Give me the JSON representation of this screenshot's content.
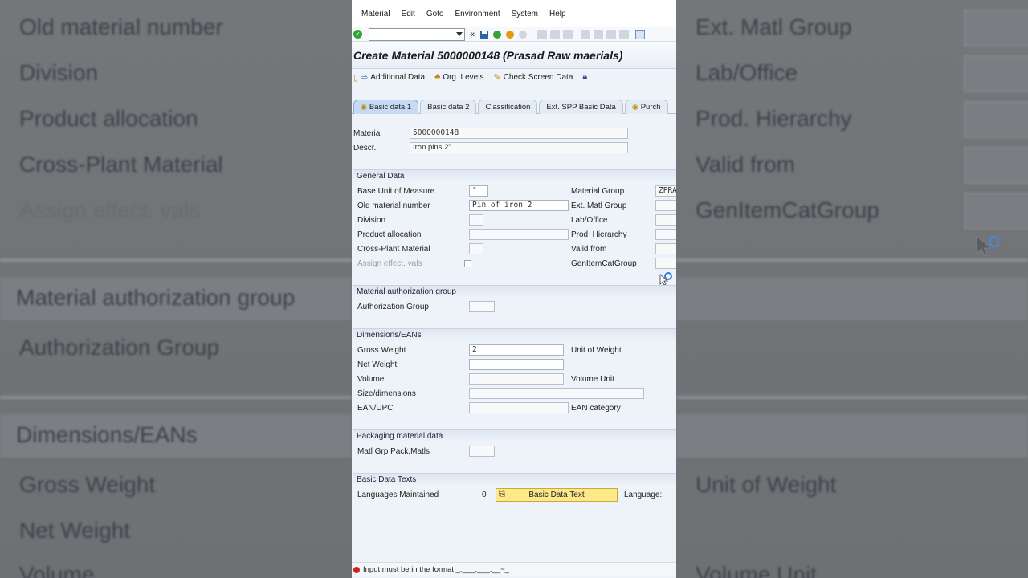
{
  "menu": [
    {
      "label": "Material"
    },
    {
      "label": "Edit"
    },
    {
      "label": "Goto"
    },
    {
      "label": "Environment"
    },
    {
      "label": "System"
    },
    {
      "label": "Help"
    }
  ],
  "toolbar": {
    "command_field": "",
    "back_glyph": "«"
  },
  "title": "Create Material 5000000148 (Prasad Raw maerials)",
  "appbar": {
    "additional_data": "Additional Data",
    "org_levels": "Org. Levels",
    "check_screen_data": "Check Screen Data"
  },
  "tabs": [
    {
      "label": "Basic data 1",
      "active": true
    },
    {
      "label": "Basic data 2"
    },
    {
      "label": "Classification"
    },
    {
      "label": "Ext. SPP Basic Data"
    },
    {
      "label": "Purch"
    }
  ],
  "header": {
    "material_label": "Material",
    "material_value": "5000000148",
    "descr_label": "Descr.",
    "descr_value": "Iron pins 2\""
  },
  "general": {
    "title": "General Data",
    "base_uom_label": "Base Unit of Measure",
    "base_uom_value": "\"",
    "old_matno_label": "Old material number",
    "old_matno_value": "Pin of iron 2",
    "division_label": "Division",
    "product_alloc_label": "Product allocation",
    "cross_plant_label": "Cross-Plant Material",
    "assign_effect_label": "Assign effect. vals",
    "matl_group_label": "Material Group",
    "matl_group_value": "ZPRA",
    "ext_matl_group_label": "Ext. Matl Group",
    "lab_office_label": "Lab/Office",
    "prod_hierarchy_label": "Prod. Hierarchy",
    "valid_from_label": "Valid from",
    "gen_item_cat_label": "GenItemCatGroup"
  },
  "auth": {
    "title": "Material authorization group",
    "auth_group_label": "Authorization Group"
  },
  "dims": {
    "title": "Dimensions/EANs",
    "gross_weight_label": "Gross Weight",
    "gross_weight_value": "2",
    "net_weight_label": "Net Weight",
    "volume_label": "Volume",
    "size_label": "Size/dimensions",
    "ean_label": "EAN/UPC",
    "unit_weight_label": "Unit of Weight",
    "volume_unit_label": "Volume Unit",
    "ean_category_label": "EAN category"
  },
  "packaging": {
    "title": "Packaging material data",
    "matl_grp_pack_label": "Matl Grp Pack.Matls"
  },
  "texts": {
    "title": "Basic Data Texts",
    "languages_label": "Languages Maintained",
    "languages_value": "0",
    "basic_data_text_button": "Basic Data Text",
    "language_label": "Language:"
  },
  "status": {
    "message": "Input must be in the format _.___.___.__~_"
  },
  "backdrop": {
    "left": [
      "Old material number",
      "Division",
      "Product allocation",
      "Cross-Plant Material",
      "Assign effect. vals",
      "Material authorization group",
      "Authorization Group",
      "Dimensions/EANs",
      "Gross Weight",
      "Net Weight",
      "Volume"
    ],
    "right": [
      "Ext. Matl Group",
      "Lab/Office",
      "Prod. Hierarchy",
      "Valid from",
      "GenItemCatGroup",
      "Unit of Weight",
      "Volume Unit"
    ]
  },
  "colors": {
    "accent_yellow": "#fde98a",
    "tab_active": "#c7daf3",
    "error_red": "#d02020",
    "ok_green": "#2fa52f"
  }
}
